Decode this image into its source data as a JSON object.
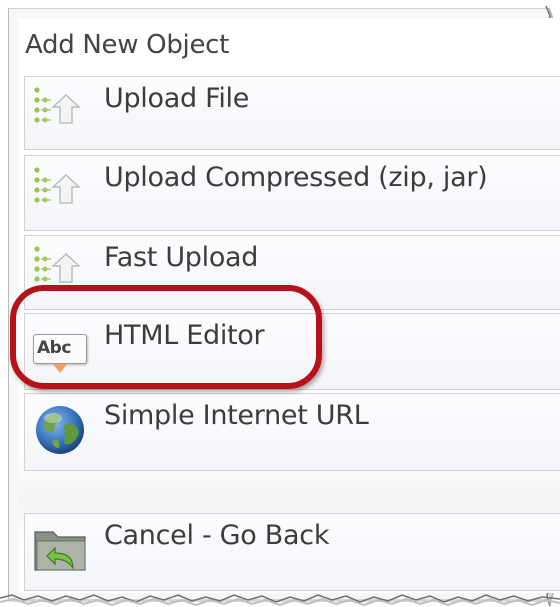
{
  "dialog": {
    "title": "Add New Object",
    "items": [
      {
        "label": "Upload File",
        "icon": "upload-arrow-icon"
      },
      {
        "label": "Upload Compressed (zip, jar)",
        "icon": "upload-arrow-icon"
      },
      {
        "label": "Fast Upload",
        "icon": "upload-arrow-icon"
      },
      {
        "label": "HTML Editor",
        "icon": "abc-editor-icon",
        "icon_text": "Abc"
      },
      {
        "label": "Simple Internet URL",
        "icon": "globe-icon"
      },
      {
        "label": "Cancel - Go Back",
        "icon": "folder-back-icon"
      }
    ]
  },
  "colors": {
    "highlight": "#b5121b",
    "text": "#3c3c3c"
  }
}
